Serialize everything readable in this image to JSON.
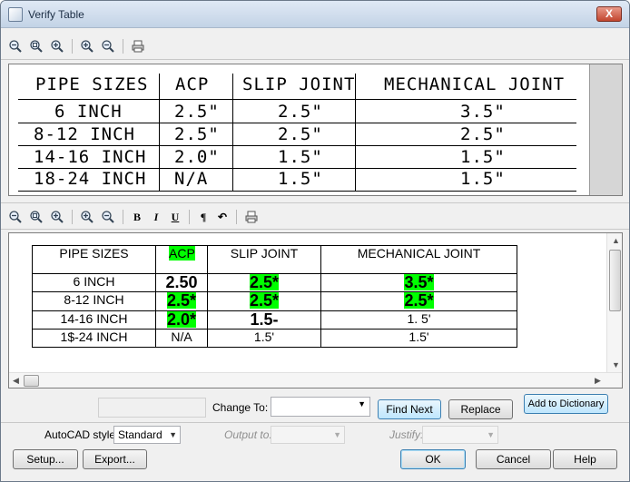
{
  "window": {
    "title": "Verify Table",
    "close_symbol": "X"
  },
  "preview_toolbar": {
    "icons": [
      "zoom-out-icon",
      "zoom-fit-icon",
      "zoom-in-icon",
      "zoom-in-2-icon",
      "zoom-out-2-icon",
      "print-icon"
    ]
  },
  "preview_table": {
    "headers": [
      "PIPE SIZES",
      "ACP",
      "SLIP JOINT",
      "MECHANICAL JOINT"
    ],
    "rows": [
      [
        "6 INCH",
        "2.5\"",
        "2.5\"",
        "3.5\""
      ],
      [
        "8-12 INCH",
        "2.5\"",
        "2.5\"",
        "2.5\""
      ],
      [
        "14-16 INCH",
        "2.0\"",
        "1.5\"",
        "1.5\""
      ],
      [
        "18-24 INCH",
        "N/A",
        "1.5\"",
        "1.5\""
      ]
    ]
  },
  "edit_toolbar": {
    "bold": "B",
    "italic": "I",
    "underline": "U",
    "paragraph": "¶",
    "undo": "↶"
  },
  "edit_table": {
    "headers": [
      "PIPE SIZES",
      "ACP",
      "SLIP JOINT",
      "MECHANICAL JOINT"
    ],
    "rows": [
      [
        "6 INCH",
        "2.50",
        "2.5*",
        "3.5*"
      ],
      [
        "8-12 INCH",
        "2.5*",
        "2.5*",
        "2.5*"
      ],
      [
        "14-16 INCH",
        "2.0*",
        "1.5-",
        "1. 5'"
      ],
      [
        "1$-24 INCH",
        "N/A",
        "1.5'",
        "1.5'"
      ]
    ],
    "highlight_color": "#00ff00"
  },
  "spell": {
    "change_to_label": "Change To:",
    "change_to_value": "",
    "find_next": "Find Next",
    "replace": "Replace",
    "add_to_dictionary": "Add to Dictionary"
  },
  "options": {
    "style_label": "AutoCAD style:",
    "style_value": "Standard",
    "output_label": "Output to:",
    "output_value": "",
    "justify_label": "Justify:",
    "justify_value": ""
  },
  "footer": {
    "setup": "Setup...",
    "export": "Export...",
    "ok": "OK",
    "cancel": "Cancel",
    "help": "Help"
  }
}
